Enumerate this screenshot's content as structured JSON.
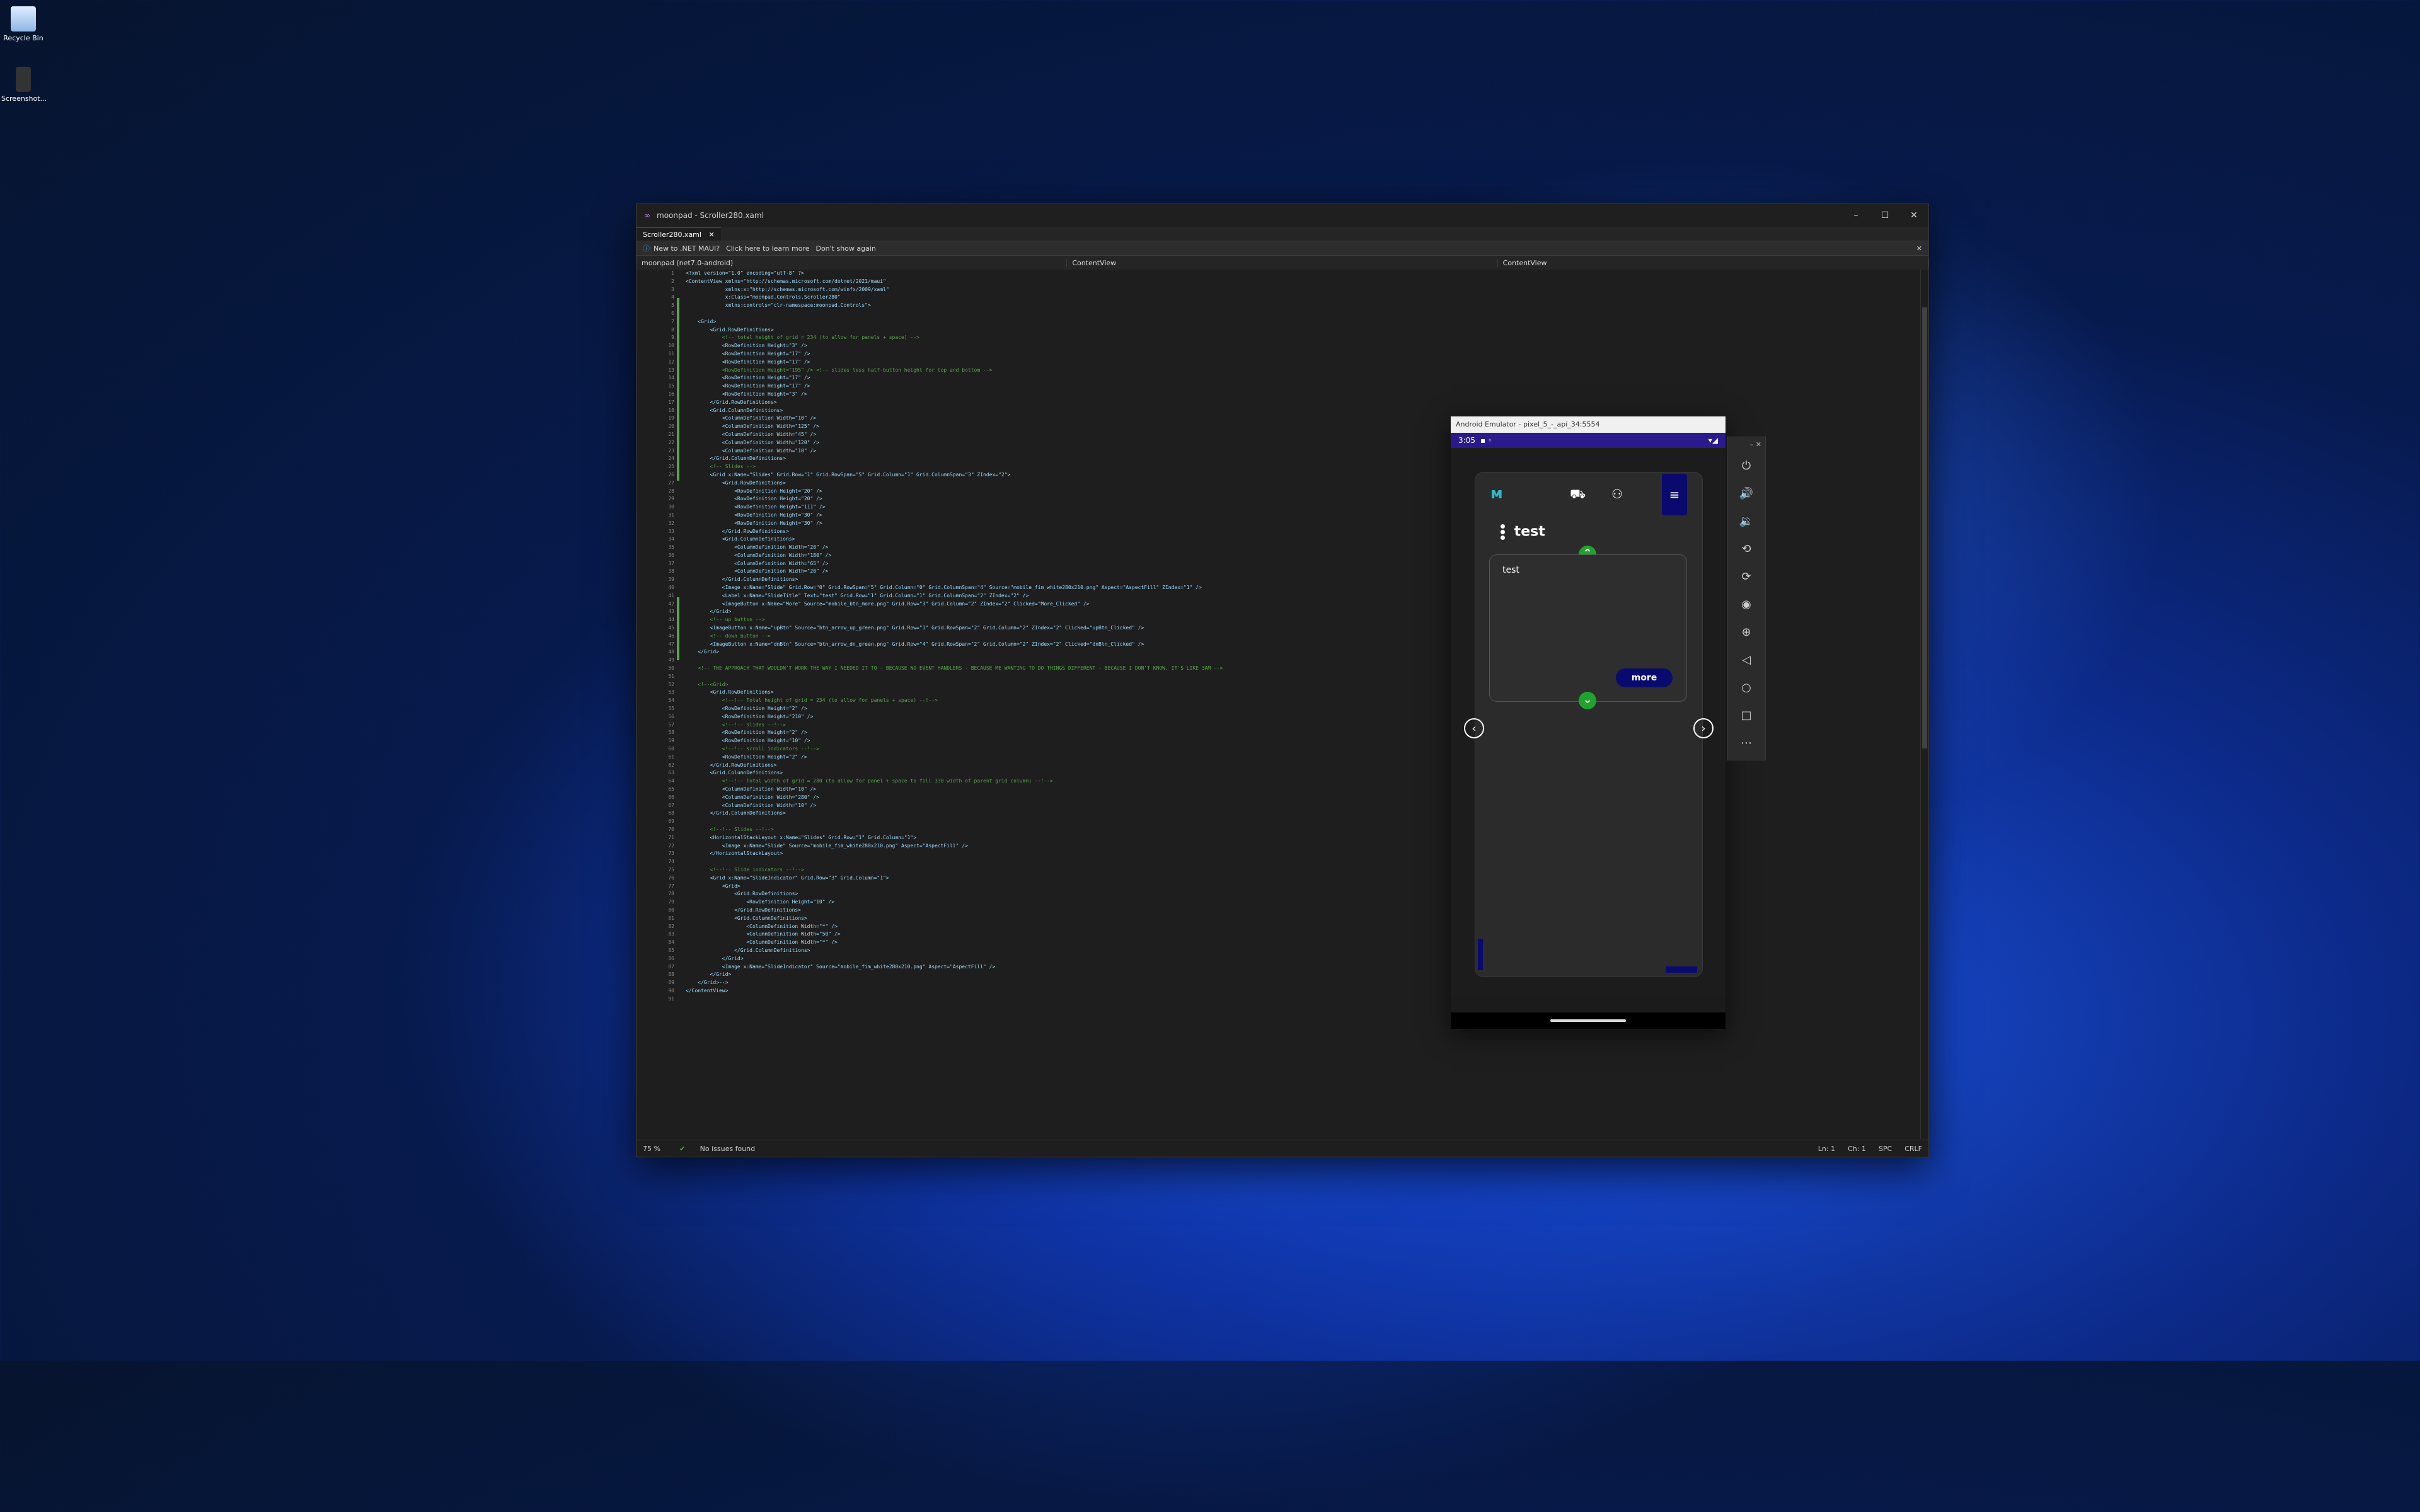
{
  "desktop": {
    "icons": [
      {
        "label": "Recycle Bin",
        "icon": "recycle-bin-icon"
      },
      {
        "label": "Screenshot...",
        "icon": "file-icon"
      }
    ]
  },
  "vs": {
    "title": "moonpad - Scroller280.xaml",
    "tab_label": "Scroller280.xaml",
    "info_text": "New to .NET MAUI?",
    "info_link": "Click here to learn more",
    "info_dismiss": "Don't show again",
    "project_dropdown": "moonpad (net7.0-android)",
    "scope_dropdown_1": "ContentView",
    "scope_dropdown_2": "ContentView",
    "code_lines": [
      "<?xml version=\"1.0\" encoding=\"utf-8\" ?>",
      "<ContentView xmlns=\"http://schemas.microsoft.com/dotnet/2021/maui\"",
      "             xmlns:x=\"http://schemas.microsoft.com/winfx/2009/xaml\"",
      "             x:Class=\"moonpad.Controls.Scroller280\"",
      "             xmlns:controls=\"clr-namespace:moonpad.Controls\">",
      "",
      "    <Grid>",
      "        <Grid.RowDefinitions>",
      "            <!-- total height of grid = 234 (to allow for panels + space) -->",
      "            <RowDefinition Height=\"3\" />",
      "            <RowDefinition Height=\"17\" />",
      "            <RowDefinition Height=\"17\" />",
      "            <RowDefinition Height=\"195\" /> <!-- slides less half-button height for top and bottom -->",
      "            <RowDefinition Height=\"17\" />",
      "            <RowDefinition Height=\"17\" />",
      "            <RowDefinition Height=\"3\" />",
      "        </Grid.RowDefinitions>",
      "        <Grid.ColumnDefinitions>",
      "            <ColumnDefinition Width=\"10\" />",
      "            <ColumnDefinition Width=\"125\" />",
      "            <ColumnDefinition Width=\"45\" />",
      "            <ColumnDefinition Width=\"120\" />",
      "            <ColumnDefinition Width=\"10\" />",
      "        </Grid.ColumnDefinitions>",
      "        <!-- Slides -->",
      "        <Grid x:Name=\"Slides\" Grid.Row=\"1\" Grid.RowSpan=\"5\" Grid.Column=\"1\" Grid.ColumnSpan=\"3\" ZIndex=\"2\">",
      "            <Grid.RowDefinitions>",
      "                <RowDefinition Height=\"20\" />",
      "                <RowDefinition Height=\"20\" />",
      "                <RowDefinition Height=\"111\" />",
      "                <RowDefinition Height=\"30\" />",
      "                <RowDefinition Height=\"30\" />",
      "            </Grid.RowDefinitions>",
      "            <Grid.ColumnDefinitions>",
      "                <ColumnDefinition Width=\"20\" />",
      "                <ColumnDefinition Width=\"180\" />",
      "                <ColumnDefinition Width=\"65\" />",
      "                <ColumnDefinition Width=\"20\" />",
      "            </Grid.ColumnDefinitions>",
      "            <Image x:Name=\"Slide\" Grid.Row=\"0\" Grid.RowSpan=\"5\" Grid.Column=\"0\" Grid.ColumnSpan=\"4\" Source=\"mobile_fim_white280x210.png\" Aspect=\"AspectFill\" ZIndex=\"1\" />",
      "            <Label x:Name=\"SlideTitle\" Text=\"test\" Grid.Row=\"1\" Grid.Column=\"1\" Grid.ColumnSpan=\"2\" ZIndex=\"2\" />",
      "            <ImageButton x:Name=\"More\" Source=\"mobile_btn_more.png\" Grid.Row=\"3\" Grid.Column=\"2\" ZIndex=\"2\" Clicked=\"More_Clicked\" />",
      "        </Grid>",
      "        <!-- up button -->",
      "        <ImageButton x:Name=\"upBtn\" Source=\"btn_arrow_up_green.png\" Grid.Row=\"1\" Grid.RowSpan=\"2\" Grid.Column=\"2\" ZIndex=\"2\" Clicked=\"upBtn_Clicked\" />",
      "        <!-- down button -->",
      "        <ImageButton x:Name=\"dnBtn\" Source=\"btn_arrow_dn_green.png\" Grid.Row=\"4\" Grid.RowSpan=\"2\" Grid.Column=\"2\" ZIndex=\"2\" Clicked=\"dnBtn_Clicked\" />",
      "    </Grid>",
      "",
      "    <!-- THE APPROACH THAT WOULDN'T WORK THE WAY I NEEDED IT TO - BECAUSE NO EVENT HANDLERS - BECAUSE ME WANTING TO DO THINGS DIFFERENT - BECAUSE I DON'T KNOW, IT'S LIKE 3AM -->",
      "",
      "    <!--<Grid>",
      "        <Grid.RowDefinitions>",
      "            <!--!-- Total height of grid = 234 (to allow for panels + space) --!-->",
      "            <RowDefinition Height=\"2\" />",
      "            <RowDefinition Height=\"210\" />",
      "            <!--!-- slides --!-->",
      "            <RowDefinition Height=\"2\" />",
      "            <RowDefinition Height=\"10\" />",
      "            <!--!-- scroll indicators --!-->",
      "            <RowDefinition Height=\"2\" />",
      "        </Grid.RowDefinitions>",
      "        <Grid.ColumnDefinitions>",
      "            <!--!-- Total width of grid = 280 (to allow for panel + space to fill 330 width of parent grid column) --!-->",
      "            <ColumnDefinition Width=\"10\" />",
      "            <ColumnDefinition Width=\"280\" />",
      "            <ColumnDefinition Width=\"10\" />",
      "        </Grid.ColumnDefinitions>",
      "",
      "        <!--!-- Slides --!-->",
      "        <HorizontalStackLayout x:Name=\"Slides\" Grid.Row=\"1\" Grid.Column=\"1\">",
      "            <Image x:Name=\"Slide\" Source=\"mobile_fim_white280x210.png\" Aspect=\"AspectFill\" />",
      "        </HorizontalStackLayout>",
      "",
      "        <!--!-- Slide indicators --!-->",
      "        <Grid x:Name=\"SlideIndicator\" Grid.Row=\"3\" Grid.Column=\"1\">",
      "            <Grid>",
      "                <Grid.RowDefinitions>",
      "                    <RowDefinition Height=\"10\" />",
      "                </Grid.RowDefinitions>",
      "                <Grid.ColumnDefinitions>",
      "                    <ColumnDefinition Width=\"*\" />",
      "                    <ColumnDefinition Width=\"50\" />",
      "                    <ColumnDefinition Width=\"*\" />",
      "                </Grid.ColumnDefinitions>",
      "            </Grid>",
      "            <Image x:Name=\"SlideIndicator\" Source=\"mobile_fim_white280x210.png\" Aspect=\"AspectFill\" />",
      "        </Grid>",
      "    </Grid>-->",
      "</ContentView>",
      ""
    ],
    "status": {
      "zoom": "75 %",
      "issues": "No issues found",
      "ln": "Ln: 1",
      "ch": "Ch: 1",
      "spc": "SPC",
      "crlf": "CRLF"
    }
  },
  "emulator": {
    "title": "Android Emulator - pixel_5_-_api_34:5554",
    "time": "3:05",
    "slide_title": "test",
    "panel_text": "test",
    "more_label": "more"
  }
}
